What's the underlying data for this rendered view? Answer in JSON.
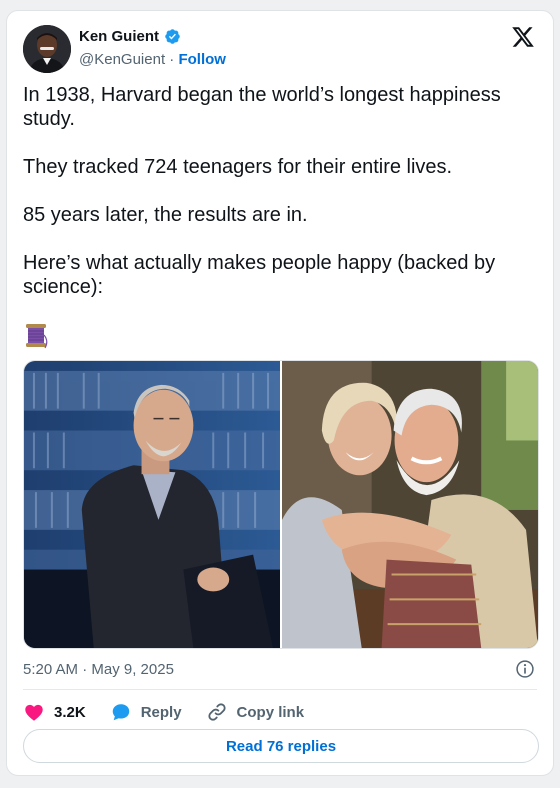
{
  "author": {
    "name": "Ken Guient",
    "handle": "@KenGuient",
    "separator": "·",
    "follow_label": "Follow"
  },
  "tweet": {
    "paragraphs": [
      "In 1938, Harvard began the world’s longest happiness study.",
      "They tracked 724 teenagers for their entire lives.",
      "85 years later, the results are in.",
      "Here’s what actually makes people happy (backed by science):"
    ],
    "emoji": "spool-of-thread"
  },
  "media": {
    "left_photo": "speaker-at-podium",
    "right_photo": "elderly-couple-embracing"
  },
  "meta": {
    "timestamp": "5:20 AM · May 9, 2025"
  },
  "actions": {
    "likes_count": "3.2K",
    "reply_label": "Reply",
    "copy_label": "Copy link"
  },
  "footer": {
    "replies_label": "Read 76 replies"
  },
  "colors": {
    "link_blue": "#006fd6",
    "like_pink": "#f91880",
    "reply_blue": "#1d9bf0",
    "verified_blue": "#1d9bf0",
    "text_dark": "#0f1419",
    "text_gray": "#536471"
  },
  "icons": [
    "verified-badge-icon",
    "x-logo-icon",
    "info-icon",
    "heart-icon",
    "reply-bubble-icon",
    "link-icon"
  ]
}
